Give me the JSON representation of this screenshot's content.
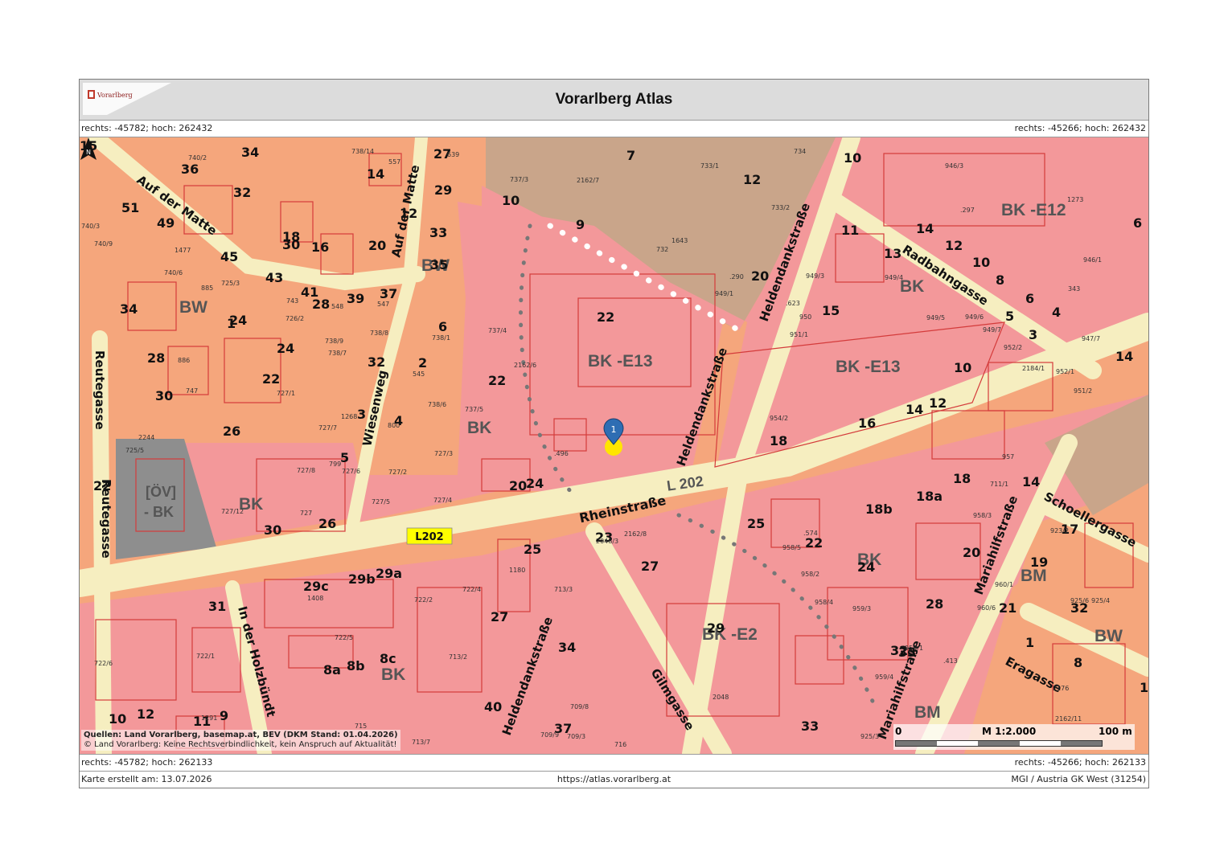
{
  "header": {
    "title": "Vorarlberg Atlas",
    "logo_text": "Vorarlberg"
  },
  "coords": {
    "top_left": "rechts: -45782; hoch: 262432",
    "top_right": "rechts: -45266; hoch: 262432",
    "bottom_left": "rechts: -45782; hoch: 262133",
    "bottom_right": "rechts: -45266; hoch: 262133"
  },
  "footer": {
    "created": "Karte erstellt am: 13.07.2026",
    "url": "https://atlas.vorarlberg.at",
    "crs": "MGI / Austria GK West (31254)"
  },
  "map": {
    "source_line1": "Quellen: Land Vorarlberg, basemap.at, BEV (DKM Stand: 01.04.2026)",
    "source_line2": "© Land Vorarlberg: Keine Rechtsverbindlichkeit, kein Anspruch auf Aktualität!",
    "scale_label": "M 1:2.000",
    "scale_start": "0",
    "scale_end": "100 m",
    "north_label": "N",
    "marker_label": "1",
    "road_badge": "L202",
    "road_number": "L 202",
    "streets": {
      "rheinstrasse": "Rheinstraße",
      "heldendank_1": "Heldendankstraße",
      "heldendank_2": "Heldendankstraße",
      "heldendank_3": "Heldendankstraße",
      "radbahngasse": "Radbahngasse",
      "mariahilf_1": "Mariahilfstraße",
      "mariahilf_2": "Mariahilfstraße",
      "schoellergasse": "Schoellergasse",
      "eragasse": "Eragasse",
      "gilmgasse": "Gilmgasse",
      "holzbuendt": "In der Holzbündt",
      "reutegasse_1": "Reutegasse",
      "reutegasse_2": "Reutegasse",
      "wiesenweg": "Wiesenweg",
      "aufdermatte_1": "Auf der Matte",
      "aufdermatte_2": "Auf der Matte"
    },
    "zones": {
      "bke13_a": "BK -E13",
      "bke13_b": "BK -E13",
      "bke12": "BK -E12",
      "bke2": "BK -E2",
      "bk_1": "BK",
      "bk_2": "BK",
      "bk_3": "BK",
      "bk_4": "BK",
      "bk_5": "BK",
      "bw_1": "BW",
      "bw_2": "BW",
      "bw_3": "BW",
      "bm_1": "BM",
      "bm_2": "BM",
      "oev": "[ÖV]",
      "oev2": "- BK"
    },
    "house_numbers": [
      "7",
      "10",
      "12",
      "14",
      "9",
      "10",
      "20",
      "22",
      "11",
      "14",
      "12",
      "10",
      "8",
      "6",
      "5",
      "4",
      "3",
      "13",
      "15",
      "10",
      "14",
      "12",
      "16",
      "18",
      "6",
      "22",
      "20",
      "24",
      "23",
      "25",
      "27",
      "29",
      "32",
      "33",
      "34",
      "37",
      "25",
      "18b",
      "18a",
      "18",
      "14",
      "17",
      "19",
      "21",
      "1",
      "8",
      "10",
      "20",
      "22",
      "24",
      "28",
      "30",
      "26",
      "32",
      "33",
      "31",
      "29c",
      "29b",
      "29a",
      "27",
      "40",
      "8a",
      "8b",
      "8c",
      "11",
      "9",
      "10",
      "12",
      "36",
      "34",
      "32",
      "30",
      "51",
      "49",
      "45",
      "43",
      "41",
      "39",
      "37",
      "35",
      "33",
      "29",
      "27",
      "16",
      "14",
      "12",
      "20",
      "18",
      "28",
      "22",
      "24",
      "26",
      "30",
      "28",
      "34",
      "32",
      "2",
      "3",
      "4",
      "5",
      "6",
      "1",
      "24",
      "22",
      "15"
    ],
    "parcels": [
      "740/2",
      "738/14",
      "557",
      "639",
      "737/3",
      "2162/7",
      "734",
      "733/1",
      "946/3",
      "1273",
      "946/1",
      "343",
      "947/7",
      "740/3",
      "740/9",
      "1477",
      "740/6",
      "885",
      "725/3",
      "726/2",
      "743",
      "548",
      "547",
      "738/8",
      "738/9",
      "738/7",
      "886",
      "747",
      "727/1",
      "727/7",
      "727/8",
      "727/6",
      "727/2",
      "1268",
      "800",
      "799",
      "738/1",
      "545",
      "738/6",
      "737/5",
      "737/4",
      "727/3",
      "727/4",
      "727/5",
      "2244",
      "725/5",
      "727/12",
      "727",
      "1408",
      "722/2",
      "722/4",
      "713/3",
      "1180",
      "713/2",
      "715",
      "713/7",
      "709/9",
      "709/3",
      "709/8",
      "716",
      "722/5",
      "722/6",
      "722/1",
      "1291",
      "733/2",
      "732",
      "1643",
      ".297",
      ".290",
      "949/1",
      "949/3",
      "949/4",
      "949/5",
      "949/6",
      "949/7",
      "952/2",
      "2184/1",
      "952/1",
      "951/2",
      "954/2",
      "957",
      "958/3",
      ".574",
      "958/5",
      "958/2",
      "958/4",
      "959/3",
      "959/1",
      ".413",
      "959/4",
      "925/3",
      "923/2",
      "960/1",
      "960/6",
      "925/6",
      "925/4",
      "2176",
      "2162/11",
      "2048/3",
      "2162/8",
      "2162/6",
      ".496",
      "950",
      "951/1",
      ".623",
      "711/1",
      "2048"
    ]
  }
}
